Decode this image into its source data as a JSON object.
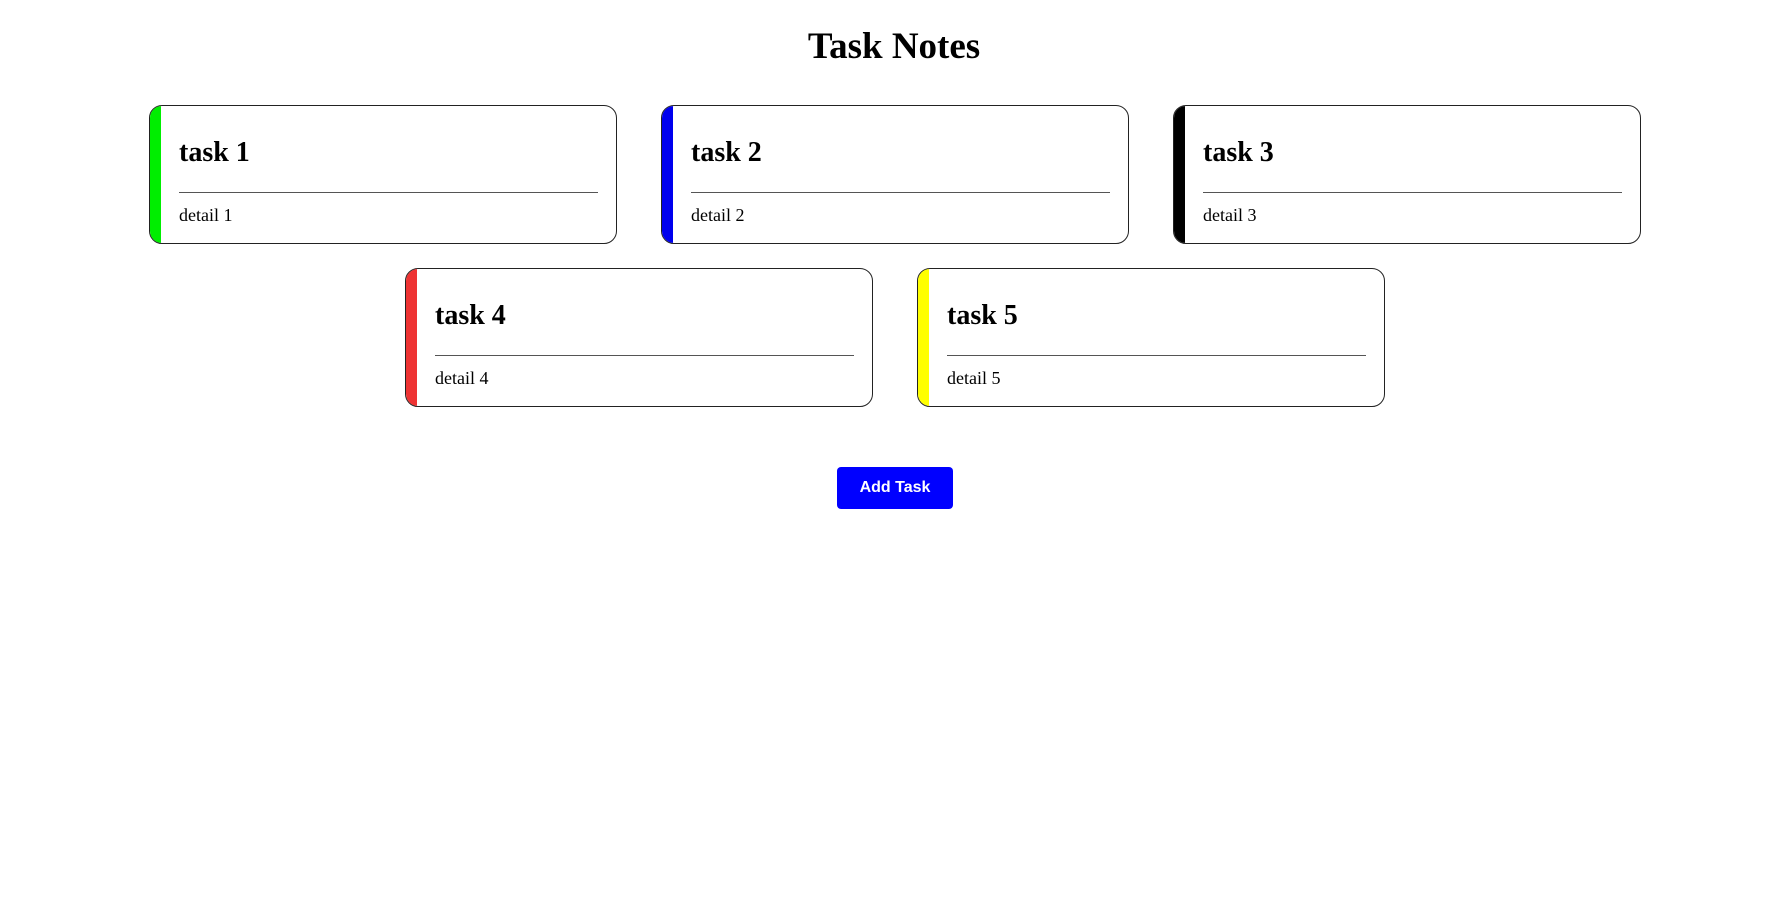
{
  "title": "Task Notes",
  "tasks": [
    {
      "title": "task 1",
      "detail": "detail 1",
      "color": "#00ee00"
    },
    {
      "title": "task 2",
      "detail": "detail 2",
      "color": "#0000ee"
    },
    {
      "title": "task 3",
      "detail": "detail 3",
      "color": "#000000"
    },
    {
      "title": "task 4",
      "detail": "detail 4",
      "color": "#ee3333"
    },
    {
      "title": "task 5",
      "detail": "detail 5",
      "color": "#ffff00"
    }
  ],
  "add_button_label": "Add Task"
}
